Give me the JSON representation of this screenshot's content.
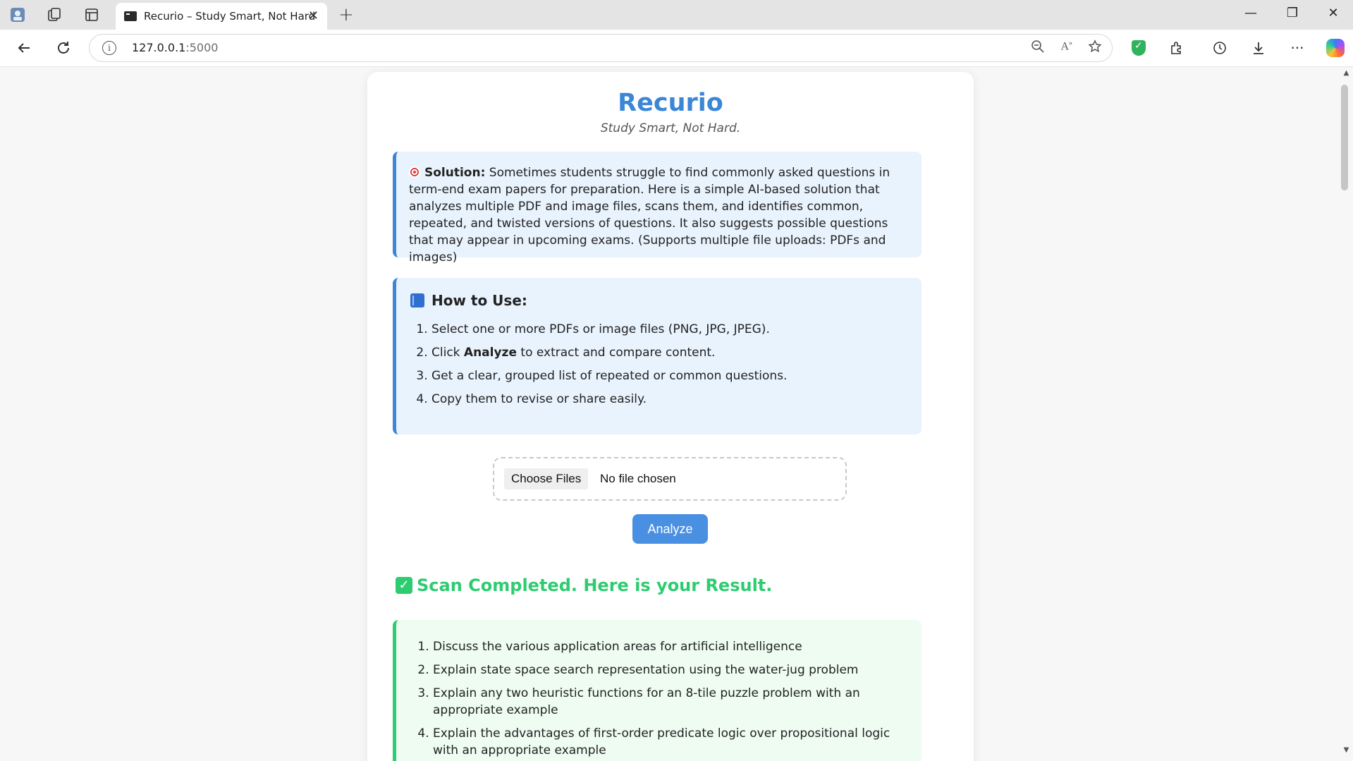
{
  "browser": {
    "tab_title": "Recurio – Study Smart, Not Hard",
    "url_host": "127.0.0.1",
    "url_port": ":5000"
  },
  "app": {
    "title": "Recurio",
    "tagline": "Study Smart, Not Hard."
  },
  "solution": {
    "label": "Solution:",
    "text": "Sometimes students struggle to find commonly asked questions in term-end exam papers for preparation. Here is a simple AI-based solution that analyzes multiple PDF and image files, scans them, and identifies common, repeated, and twisted versions of questions. It also suggests possible questions that may appear in upcoming exams. (Supports multiple file uploads: PDFs and images)"
  },
  "howto": {
    "heading": "How to Use:",
    "step1": "Select one or more PDFs or image files (PNG, JPG, JPEG).",
    "step2_before": "Click ",
    "step2_bold": "Analyze",
    "step2_after": " to extract and compare content.",
    "step3": "Get a clear, grouped list of repeated or common questions.",
    "step4": "Copy them to revise or share easily."
  },
  "upload": {
    "choose_label": "Choose Files",
    "status": "No file chosen",
    "analyze_label": "Analyze"
  },
  "result": {
    "heading": "Scan Completed. Here is your Result.",
    "items": [
      "Discuss the various application areas for artificial intelligence",
      "Explain state space search representation using the water-jug problem",
      "Explain any two heuristic functions for an 8-tile puzzle problem with an appropriate example",
      "Explain the advantages of first-order predicate logic over propositional logic with an appropriate example"
    ]
  },
  "colors": {
    "accent": "#3b86d6",
    "success": "#2ecc71",
    "button": "#4a90e2"
  }
}
